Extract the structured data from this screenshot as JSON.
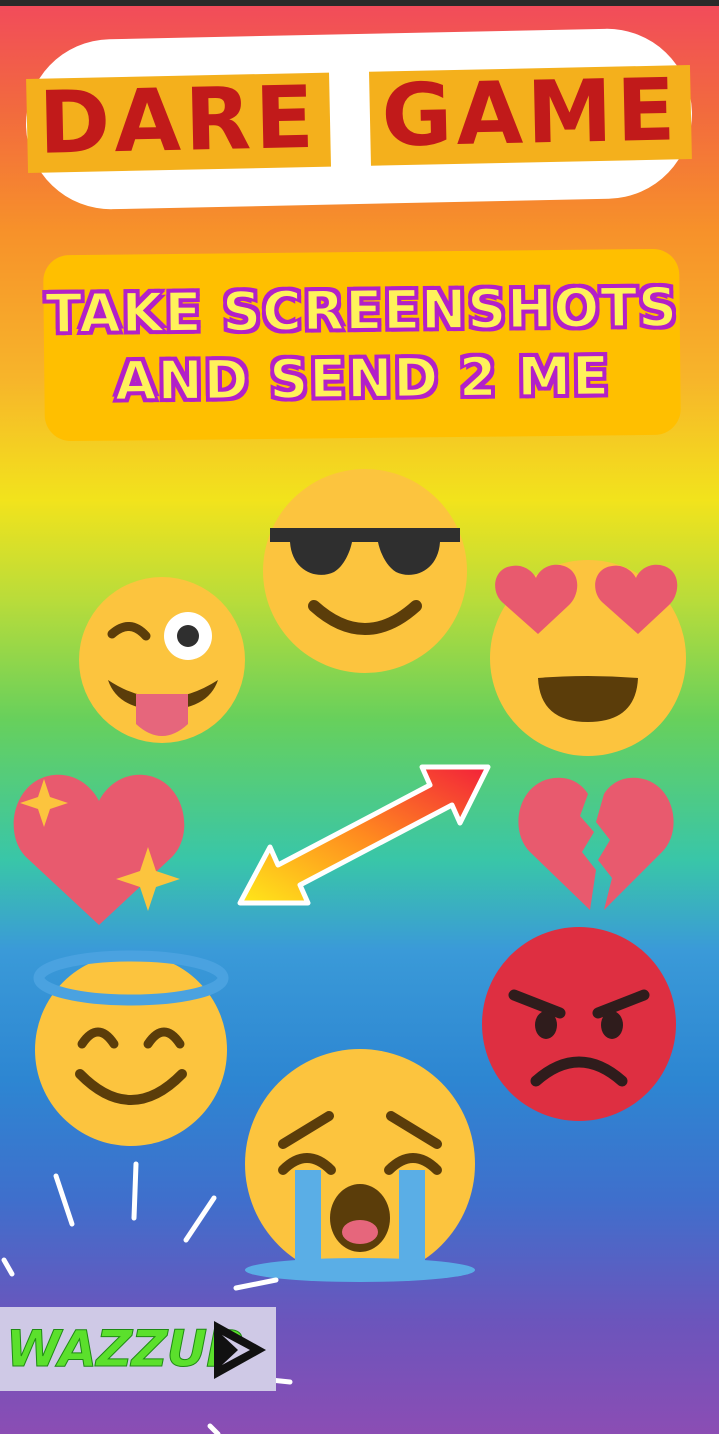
{
  "title": {
    "word1": "DARE",
    "word2": "GAME"
  },
  "instruction": {
    "line1": "TAKE SCREENSHOTS",
    "line2": "AND SEND 2 ME"
  },
  "emojis": [
    "cool-sunglasses-icon",
    "winking-tongue-icon",
    "heart-eyes-icon",
    "sparkling-heart-icon",
    "broken-heart-icon",
    "swap-arrow-icon",
    "angry-face-icon",
    "halo-smiling-face-icon",
    "crying-face-icon"
  ],
  "branding": {
    "logo_text": "WAZZUP",
    "icon": "play-icon"
  },
  "colors": {
    "title_red": "#c11a1a",
    "title_gold": "#f4b01c",
    "subtitle_fill": "#ffbf00",
    "subtitle_text": "#fff25a",
    "subtitle_outline": "#b320c8"
  }
}
